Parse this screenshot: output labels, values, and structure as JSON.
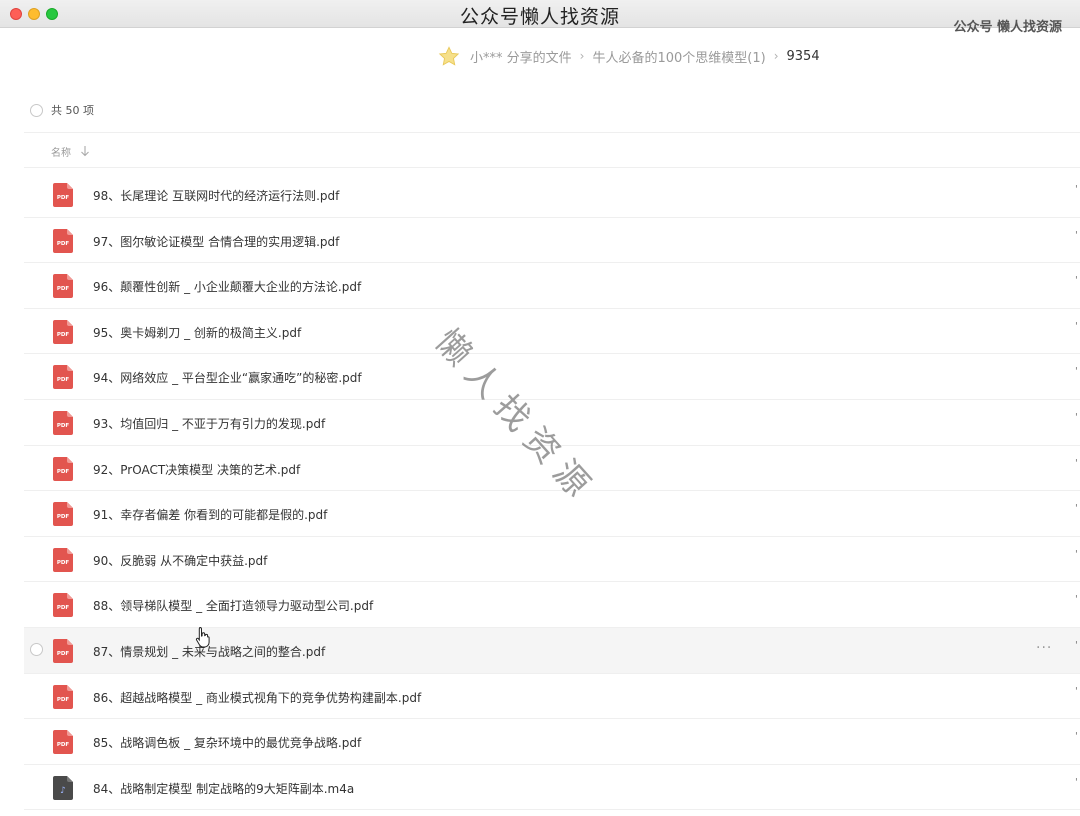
{
  "window": {
    "title": "公众号懒人找资源",
    "corner_mark": "公众号 懒人找资源"
  },
  "breadcrumb": {
    "items": [
      "小*** 分享的文件",
      "牛人必备的100个思维模型(1)"
    ],
    "current": "9354",
    "separator": "›"
  },
  "list": {
    "count_label": "共 50 项",
    "header_name": "名称",
    "more_label": "···",
    "tick": "'",
    "files": [
      {
        "name": "98、长尾理论 互联网时代的经济运行法则.pdf",
        "type": "pdf"
      },
      {
        "name": "97、图尔敏论证模型 合情合理的实用逻辑.pdf",
        "type": "pdf"
      },
      {
        "name": "96、颠覆性创新 _ 小企业颠覆大企业的方法论.pdf",
        "type": "pdf"
      },
      {
        "name": "95、奥卡姆剃刀 _ 创新的极简主义.pdf",
        "type": "pdf"
      },
      {
        "name": "94、网络效应 _ 平台型企业“赢家通吃”的秘密.pdf",
        "type": "pdf"
      },
      {
        "name": "93、均值回归 _ 不亚于万有引力的发现.pdf",
        "type": "pdf"
      },
      {
        "name": "92、PrOACT决策模型 决策的艺术.pdf",
        "type": "pdf"
      },
      {
        "name": "91、幸存者偏差 你看到的可能都是假的.pdf",
        "type": "pdf"
      },
      {
        "name": "90、反脆弱 从不确定中获益.pdf",
        "type": "pdf"
      },
      {
        "name": "88、领导梯队模型 _ 全面打造领导力驱动型公司.pdf",
        "type": "pdf"
      },
      {
        "name": "87、情景规划 _ 未来与战略之间的整合.pdf",
        "type": "pdf"
      },
      {
        "name": "86、超越战略模型 _ 商业模式视角下的竞争优势构建副本.pdf",
        "type": "pdf"
      },
      {
        "name": "85、战略调色板 _ 复杂环境中的最优竞争战略.pdf",
        "type": "pdf"
      },
      {
        "name": "84、战略制定模型 制定战略的9大矩阵副本.m4a",
        "type": "audio"
      }
    ]
  },
  "watermark": "懒人找资源",
  "icons": {
    "pdf_label": "PDF",
    "pdf_color": "#e2554f",
    "audio_color": "#4a4a4a",
    "audio_glyph": "♪",
    "star": "star-icon",
    "sort": "arrow-down-icon"
  }
}
